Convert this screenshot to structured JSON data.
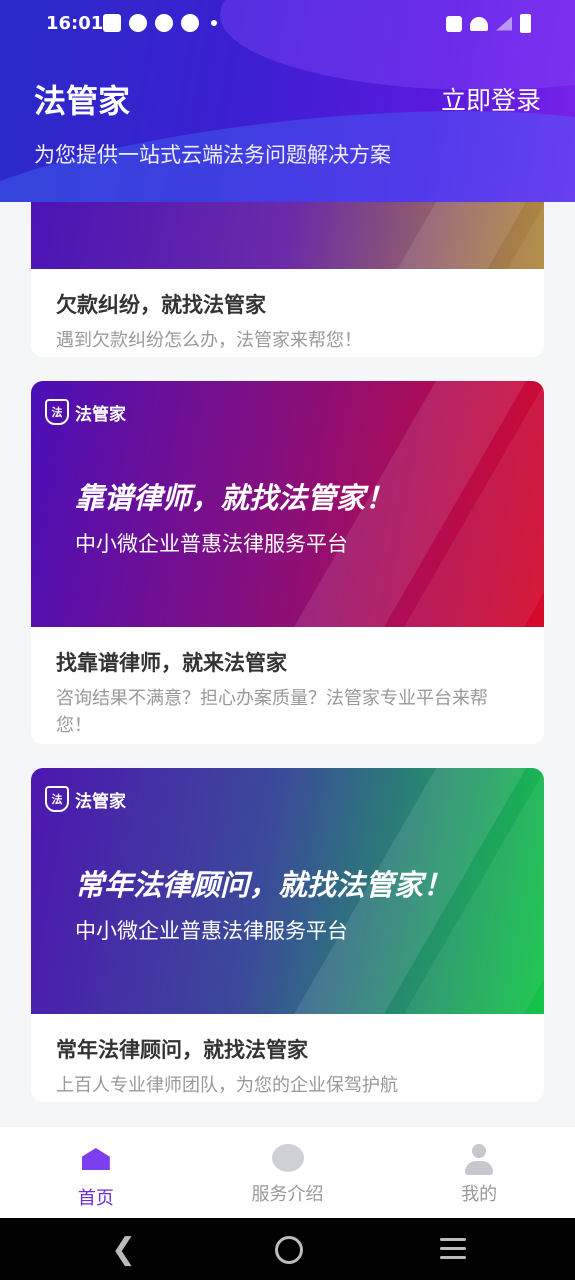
{
  "status_bar": {
    "time": "16:01"
  },
  "header": {
    "app_title": "法管家",
    "login_label": "立即登录",
    "subtitle": "为您提供一站式云端法务问题解决方案"
  },
  "cards": [
    {
      "title": "欠款纠纷，就找法管家",
      "desc": "遇到欠款纠纷怎么办，法管家来帮您！"
    },
    {
      "banner_logo": "法管家",
      "banner_headline": "靠谱律师，就找法管家！",
      "banner_tagline": "中小微企业普惠法律服务平台",
      "title": "找靠谱律师，就来法管家",
      "desc": "咨询结果不满意？担心办案质量？法管家专业平台来帮您！"
    },
    {
      "banner_logo": "法管家",
      "banner_headline": "常年法律顾问，就找法管家！",
      "banner_tagline": "中小微企业普惠法律服务平台",
      "title": "常年法律顾问，就找法管家",
      "desc": "上百人专业律师团队，为您的企业保驾护航"
    }
  ],
  "tabbar": {
    "items": [
      {
        "label": "首页",
        "icon": "home-icon",
        "active": true
      },
      {
        "label": "服务介绍",
        "icon": "service-icon",
        "active": false
      },
      {
        "label": "我的",
        "icon": "user-icon",
        "active": false
      }
    ]
  },
  "colors": {
    "header_start": "#2a2bc8",
    "header_end": "#7a22e8",
    "accent": "#6a2ee0",
    "muted_text": "#999999"
  }
}
